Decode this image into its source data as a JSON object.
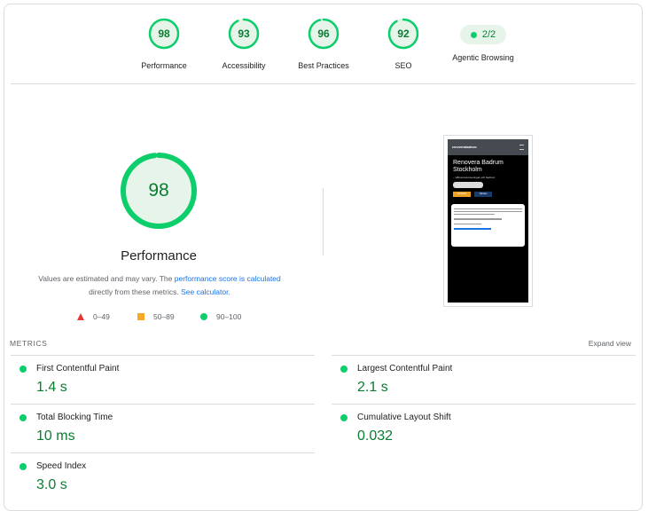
{
  "colors": {
    "pass": "#0cce6b",
    "pass_text": "#0a7d32",
    "average": "#f9a825",
    "fail": "#e53935",
    "link": "#1a73e8"
  },
  "categories": [
    {
      "score": "98",
      "label": "Performance",
      "fraction": 0.98
    },
    {
      "score": "93",
      "label": "Accessibility",
      "fraction": 0.93
    },
    {
      "score": "96",
      "label": "Best Practices",
      "fraction": 0.96
    },
    {
      "score": "92",
      "label": "SEO",
      "fraction": 0.92
    }
  ],
  "agentic": {
    "value": "2/2",
    "label": "Agentic Browsing"
  },
  "performance": {
    "score": "98",
    "fraction": 0.98,
    "title": "Performance",
    "note_prefix": "Values are estimated and may vary. The ",
    "note_link1": "performance score is calculated",
    "note_middle": " directly from these metrics. ",
    "note_link2": "See calculator.",
    "legend": {
      "fail": "0–49",
      "average": "50–89",
      "pass": "90–100"
    }
  },
  "screenshot": {
    "logo": "renoverabadrum",
    "heading": "Renovera Badrum Stockholm",
    "subheading": "– Våtrumsrenoveringar och badrum",
    "button1": "Kontakta",
    "button2": "Tjänster",
    "icon": "hamburger-menu-icon"
  },
  "metrics": {
    "title": "METRICS",
    "expand_label": "Expand view",
    "items": [
      {
        "name": "First Contentful Paint",
        "value": "1.4 s"
      },
      {
        "name": "Largest Contentful Paint",
        "value": "2.1 s"
      },
      {
        "name": "Total Blocking Time",
        "value": "10 ms"
      },
      {
        "name": "Cumulative Layout Shift",
        "value": "0.032"
      },
      {
        "name": "Speed Index",
        "value": "3.0 s"
      }
    ]
  }
}
